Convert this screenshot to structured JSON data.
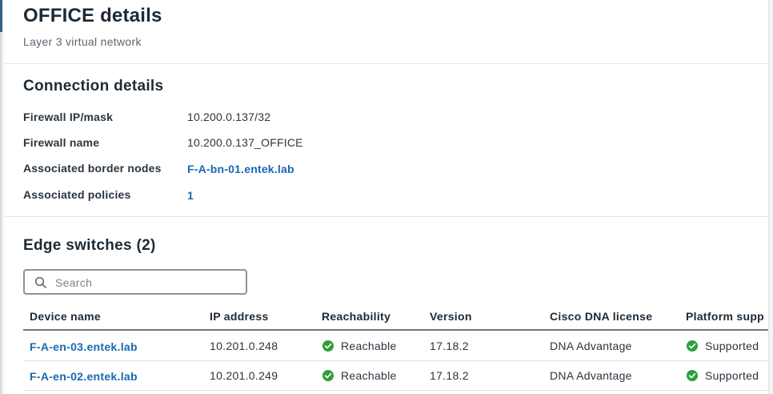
{
  "header": {
    "title": "OFFICE details",
    "subtitle": "Layer 3 virtual network"
  },
  "connection": {
    "title": "Connection details",
    "rows": [
      {
        "label": "Firewall IP/mask",
        "value": "10.200.0.137/32"
      },
      {
        "label": "Firewall name",
        "value": "10.200.0.137_OFFICE"
      },
      {
        "label": "Associated border nodes",
        "value": "F-A-bn-01.entek.lab"
      },
      {
        "label": "Associated policies",
        "value": "1"
      }
    ]
  },
  "edge": {
    "title": "Edge switches (2)",
    "search": {
      "placeholder": "Search"
    },
    "columns": [
      "Device name",
      "IP address",
      "Reachability",
      "Version",
      "Cisco DNA license",
      "Platform supp"
    ],
    "rows": [
      {
        "device": "F-A-en-03.entek.lab",
        "ip": "10.201.0.248",
        "reachability": "Reachable",
        "version": "17.18.2",
        "license": "DNA Advantage",
        "platform": "Supported"
      },
      {
        "device": "F-A-en-02.entek.lab",
        "ip": "10.201.0.249",
        "reachability": "Reachable",
        "version": "17.18.2",
        "license": "DNA Advantage",
        "platform": "Supported"
      }
    ]
  },
  "colors": {
    "link": "#1a68b3",
    "success": "#2e9e3a",
    "heading": "#1d2a35"
  }
}
